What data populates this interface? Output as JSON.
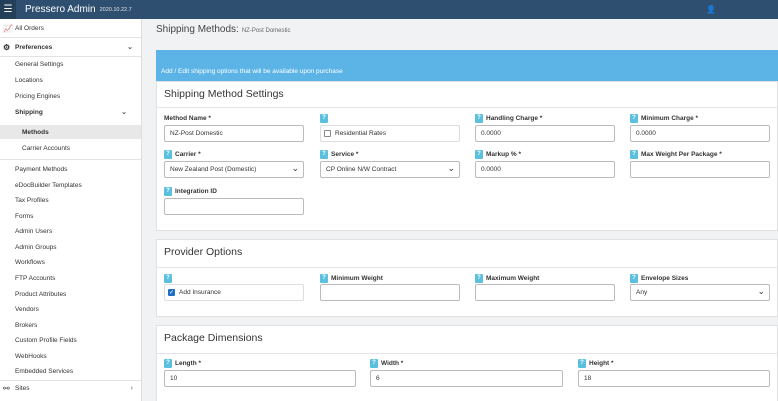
{
  "app": {
    "title": "Pressero Admin",
    "version": "2020.10.22.7"
  },
  "sidebar": {
    "all_orders": "All Orders",
    "preferences": "Preferences",
    "general_settings": "General Settings",
    "locations": "Locations",
    "pricing_engines": "Pricing Engines",
    "shipping": "Shipping",
    "methods": "Methods",
    "carrier_accounts": "Carrier Accounts",
    "items": [
      "Payment Methods",
      "eDocBuilder Templates",
      "Tax Profiles",
      "Forms",
      "Admin Users",
      "Admin Groups",
      "Workflows",
      "FTP Accounts",
      "Product Attributes",
      "Vendors",
      "Brokers",
      "Custom Profile Fields",
      "WebHooks",
      "Embedded Services"
    ],
    "sites": "Sites"
  },
  "page": {
    "title": "Shipping Methods:",
    "subtitle": "NZ-Post Domestic"
  },
  "banner": "Add / Edit shipping options that will be available upon purchase",
  "help_glyph": "?",
  "settings": {
    "heading": "Shipping Method Settings",
    "method_name": {
      "label": "Method Name *",
      "value": "NZ-Post Domestic"
    },
    "residential": {
      "label": "Residential Rates"
    },
    "handling_charge": {
      "label": "Handling Charge *",
      "value": "0.0000"
    },
    "minimum_charge": {
      "label": "Minimum Charge *",
      "value": "0.0000"
    },
    "carrier": {
      "label": "Carrier *",
      "value": "New Zealand Post (Domestic)"
    },
    "service": {
      "label": "Service *",
      "value": "CP Online N/W Contract"
    },
    "markup": {
      "label": "Markup % *",
      "value": "0.0000"
    },
    "max_weight": {
      "label": "Max Weight Per Package *",
      "value": ""
    },
    "integration_id": {
      "label": "Integration ID",
      "value": ""
    }
  },
  "provider": {
    "heading": "Provider Options",
    "add_insurance": {
      "label": "Add Insurance",
      "checked": true
    },
    "min_weight": {
      "label": "Minimum Weight",
      "value": ""
    },
    "max_weight": {
      "label": "Maximum Weight",
      "value": ""
    },
    "envelope": {
      "label": "Envelope Sizes",
      "value": "Any"
    }
  },
  "package": {
    "heading": "Package Dimensions",
    "length": {
      "label": "Length *",
      "value": "10"
    },
    "width": {
      "label": "Width *",
      "value": "6"
    },
    "height": {
      "label": "Height *",
      "value": "18"
    }
  }
}
